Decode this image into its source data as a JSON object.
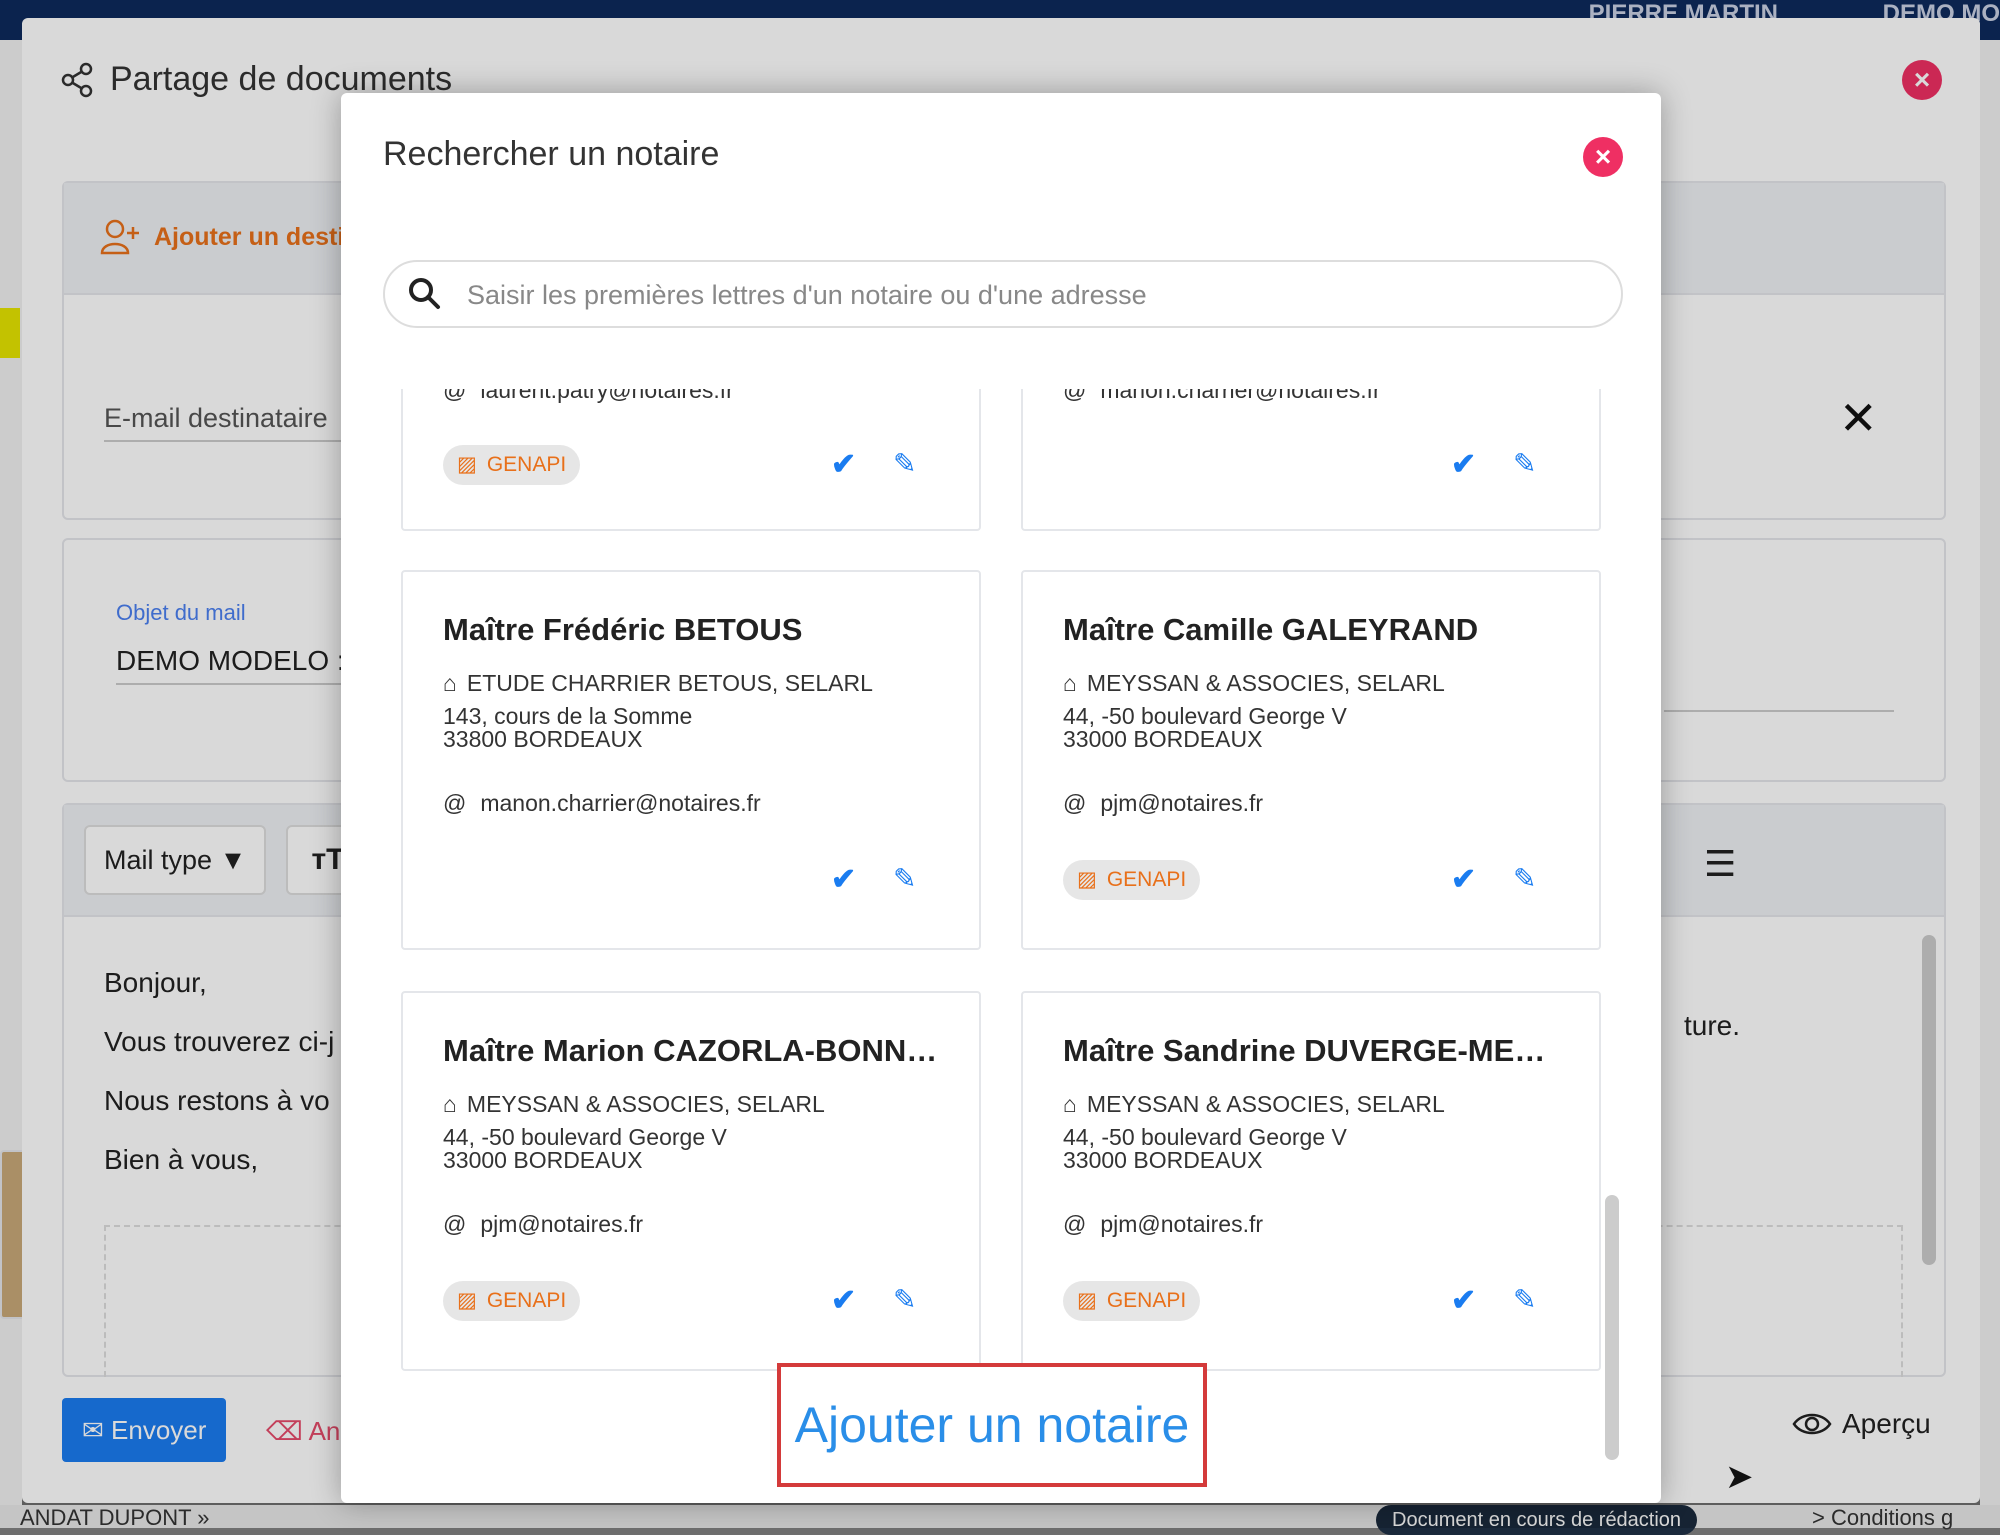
{
  "background": {
    "user_name": "PIERRE MARTIN",
    "company": "DEMO MO",
    "bottom_left": "ANDAT DUPONT »",
    "bottom_pill": "Document en cours de rédaction",
    "bottom_right": "> Conditions g"
  },
  "outer_modal": {
    "title": "Partage de documents",
    "add_recipient": "Ajouter un desti",
    "email_label": "E-mail destinataire",
    "subject_label": "Objet du mail",
    "subject_value": "DEMO MODELO :",
    "mail_type": "Mail type",
    "body_lines": [
      "Bonjour,",
      "Vous trouverez ci-j",
      "Nous restons à vo",
      "Bien à vous,"
    ],
    "body_right_fragment": "ture.",
    "send_button": "Envoyer",
    "cancel_button": "An",
    "preview_button": "Aperçu"
  },
  "search_modal": {
    "title": "Rechercher un notaire",
    "search_placeholder": "Saisir les premières lettres d'un notaire ou d'une adresse",
    "add_button": "Ajouter un notaire",
    "cards": [
      {
        "name": "",
        "etude": "",
        "address_line1": "",
        "address_line2": "",
        "email": "laurent.patry@notaires.fr",
        "badge": "GENAPI"
      },
      {
        "name": "",
        "etude": "",
        "address_line1": "",
        "address_line2": "",
        "email": "manon.charrier@notaires.fr",
        "badge": ""
      },
      {
        "name": "Maître Frédéric BETOUS",
        "etude": "ETUDE CHARRIER BETOUS, SELARL",
        "address_line1": "143, cours de la Somme",
        "address_line2": "33800 BORDEAUX",
        "email": "manon.charrier@notaires.fr",
        "badge": ""
      },
      {
        "name": "Maître Camille GALEYRAND",
        "etude": "MEYSSAN & ASSOCIES, SELARL",
        "address_line1": "44, -50 boulevard George V",
        "address_line2": "33000 BORDEAUX",
        "email": "pjm@notaires.fr",
        "badge": "GENAPI"
      },
      {
        "name": "Maître Marion CAZORLA-BONNA…",
        "etude": "MEYSSAN & ASSOCIES, SELARL",
        "address_line1": "44, -50 boulevard George V",
        "address_line2": "33000 BORDEAUX",
        "email": "pjm@notaires.fr",
        "badge": "GENAPI"
      },
      {
        "name": "Maître Sandrine DUVERGE-MEYS…",
        "etude": "MEYSSAN & ASSOCIES, SELARL",
        "address_line1": "44, -50 boulevard George V",
        "address_line2": "33000 BORDEAUX",
        "email": "pjm@notaires.fr",
        "badge": "GENAPI"
      }
    ]
  },
  "colors": {
    "accent": "#1a7cf0",
    "close": "#ef2f63",
    "orange": "#e8701a",
    "highlight": "#d43a3a"
  }
}
